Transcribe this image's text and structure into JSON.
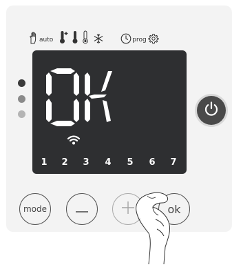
{
  "modes": {
    "hand_icon": "hand-icon",
    "auto_label": "auto",
    "thermo_plus_icon": "thermometer-plus-icon",
    "thermo_full_icon": "thermometer-full-icon",
    "thermo_low_icon": "thermometer-low-icon",
    "snowflake_icon": "snowflake-icon",
    "clock_icon": "clock-icon",
    "prog_label": "prog",
    "gear_icon": "gear-icon"
  },
  "display": {
    "text": "OK",
    "wifi_icon": "wifi-icon",
    "days": [
      "1",
      "2",
      "3",
      "4",
      "5",
      "6",
      "7"
    ]
  },
  "indicators": [
    {
      "color": "#3a3a3a"
    },
    {
      "color": "#8a8a8a"
    },
    {
      "color": "#b4b4b4"
    }
  ],
  "buttons": {
    "mode_label": "mode",
    "minus_icon": "minus-icon",
    "plus_icon": "plus-icon",
    "ok_label": "ok",
    "power_icon": "power-icon"
  },
  "colors": {
    "panel": "#f3f3f3",
    "display_bg": "#2e2f31",
    "segment_on": "#ffffff",
    "power_button": "#4a4a4a"
  }
}
